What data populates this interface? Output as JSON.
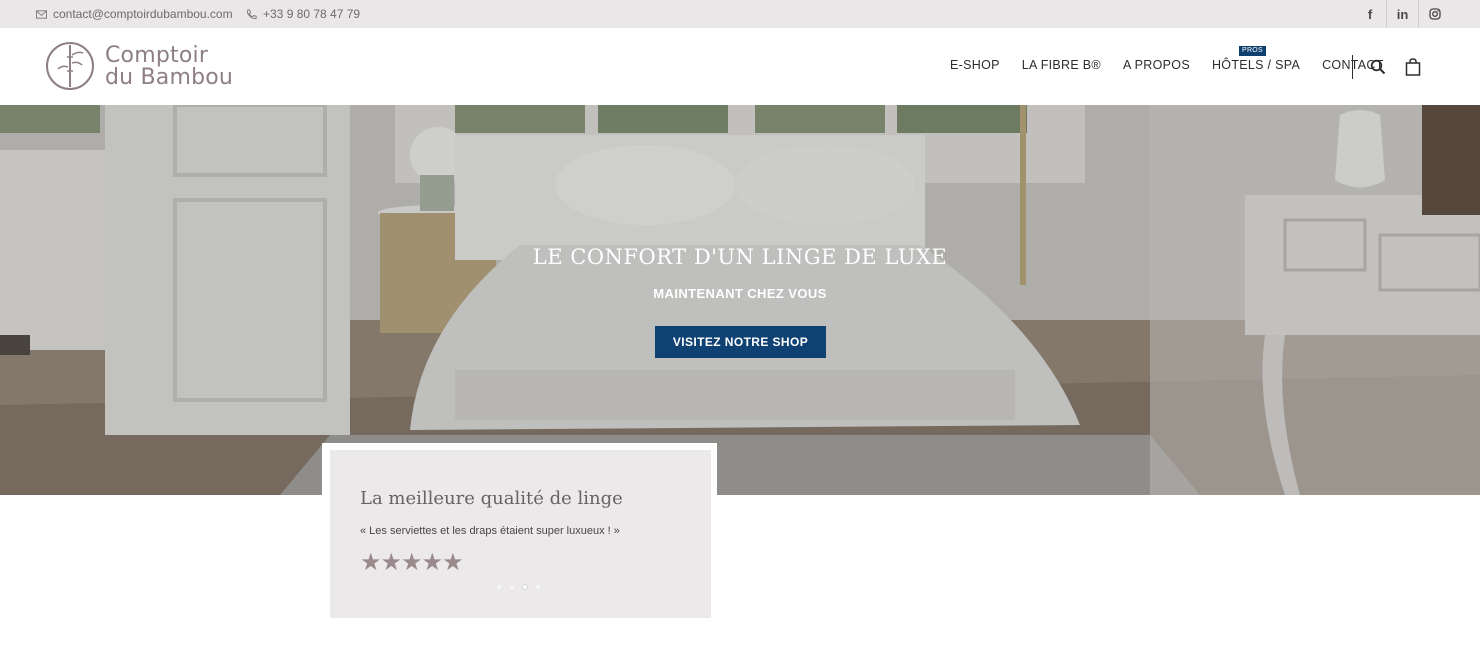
{
  "topbar": {
    "email": "contact@comptoirdubambou.com",
    "phone": "+33 9 80 78 47 79",
    "email_icon": "mail-icon",
    "phone_icon": "phone-icon",
    "socials": [
      {
        "name": "facebook",
        "glyph": "f"
      },
      {
        "name": "linkedin",
        "glyph": "in"
      },
      {
        "name": "instagram",
        "glyph": "instagram-icon"
      }
    ]
  },
  "header": {
    "logo_line1": "Comptoir",
    "logo_line2": "du Bambou",
    "nav": [
      {
        "label": "E-SHOP"
      },
      {
        "label": "LA FIBRE B®"
      },
      {
        "label": "A PROPOS"
      },
      {
        "label": "HÔTELS / SPA",
        "badge": "PROS"
      },
      {
        "label": "CONTACT"
      }
    ],
    "icons": [
      "search-icon",
      "cart-icon"
    ]
  },
  "hero": {
    "title": "LE CONFORT D'UN LINGE DE LUXE",
    "subtitle": "MAINTENANT CHEZ VOUS",
    "cta": "VISITEZ NOTRE SHOP"
  },
  "testimonial": {
    "title": "La meilleure qualité de linge",
    "quote": "« Les serviettes et les draps étaient super luxueux ! »",
    "rating": 5,
    "stars": "★★★★★",
    "slides": 4,
    "active_slide": 3
  },
  "colors": {
    "accent": "#0f4272",
    "topbar_bg": "#e9e7e7",
    "card_bg": "#ebe9e9",
    "logo": "#8d7f82",
    "star": "#9a8a8d"
  }
}
